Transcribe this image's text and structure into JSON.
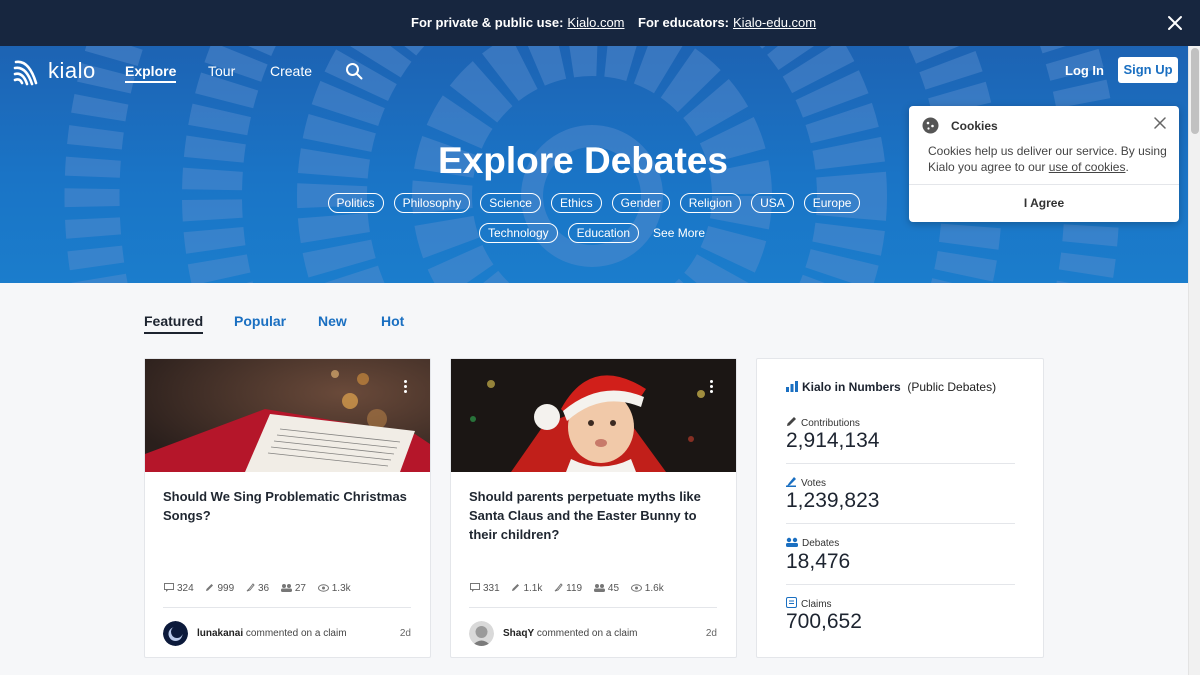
{
  "announcement": {
    "private_label": "For private & public use:",
    "private_link": "Kialo.com",
    "educators_label": "For educators:",
    "educators_link": "Kialo-edu.com"
  },
  "nav": {
    "logo_text": "kialo",
    "links": [
      "Explore",
      "Tour",
      "Create"
    ],
    "login": "Log In",
    "signup": "Sign Up"
  },
  "hero": {
    "title": "Explore Debates",
    "tags_row1": [
      "Politics",
      "Philosophy",
      "Science",
      "Ethics",
      "Gender",
      "Religion",
      "USA",
      "Europe"
    ],
    "tags_row2": [
      "Technology",
      "Education"
    ],
    "see_more": "See More"
  },
  "tabs": [
    "Featured",
    "Popular",
    "New",
    "Hot"
  ],
  "cards": [
    {
      "title": "Should We Sing Problematic Christmas Songs?",
      "stats": {
        "comments": "324",
        "contributions": "999",
        "votes": "36",
        "participants": "27",
        "views": "1.3k"
      },
      "author": "lunakanai",
      "action": "commented on a claim",
      "ago": "2d"
    },
    {
      "title": "Should parents perpetuate myths like Santa Claus and the Easter Bunny to their children?",
      "stats": {
        "comments": "331",
        "contributions": "1.1k",
        "votes": "119",
        "participants": "45",
        "views": "1.6k"
      },
      "author": "ShaqY",
      "action": "commented on a claim",
      "ago": "2d"
    }
  ],
  "numbers": {
    "title": "Kialo in Numbers",
    "subtitle": "(Public Debates)",
    "items": [
      {
        "label": "Contributions",
        "value": "2,914,134"
      },
      {
        "label": "Votes",
        "value": "1,239,823"
      },
      {
        "label": "Debates",
        "value": "18,476"
      },
      {
        "label": "Claims",
        "value": "700,652"
      }
    ]
  },
  "cookie": {
    "title": "Cookies",
    "text_before": "Cookies help us deliver our service. By using Kialo you agree to our ",
    "link": "use of cookies",
    "text_after": ".",
    "agree": "I Agree"
  },
  "colors": {
    "topbar": "#17263f",
    "hero_blue": "#1a6fc1",
    "link_blue": "#1a6fc1",
    "text_dark": "#1d2430"
  }
}
